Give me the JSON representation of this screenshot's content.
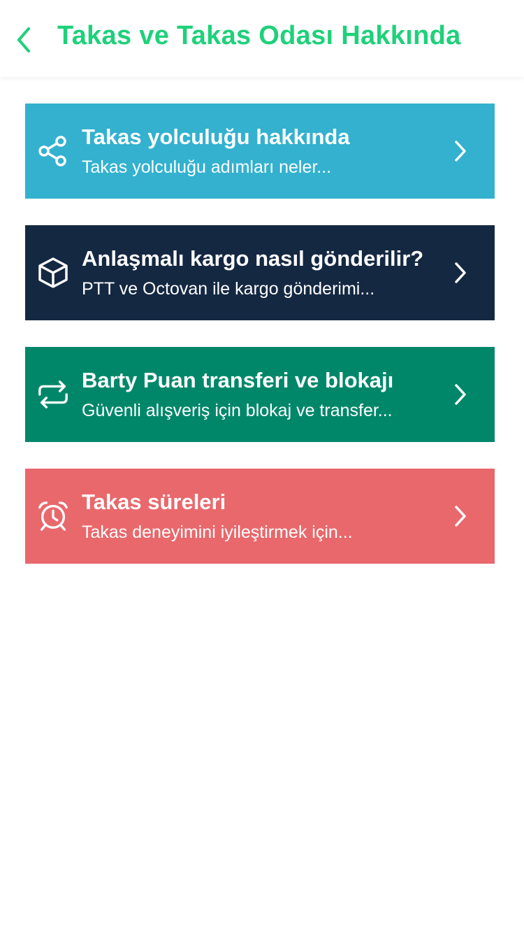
{
  "header": {
    "title": "Takas ve Takas Odası Hakkında",
    "back_icon": "chevron-left-icon",
    "accent_color": "#1ed17a"
  },
  "cards": [
    {
      "title": "Takas yolculuğu hakkında",
      "subtitle": "Takas yolculuğu adımları neler...",
      "icon": "share-icon",
      "color": "#33b1cf"
    },
    {
      "title": "Anlaşmalı kargo nasıl gönderilir?",
      "subtitle": "PTT ve Octovan ile kargo gönderimi...",
      "icon": "box-icon",
      "color": "#152842"
    },
    {
      "title": "Barty Puan transferi ve blokajı",
      "subtitle": "Güvenli alışveriş için blokaj ve transfer...",
      "icon": "repeat-icon",
      "color": "#00876a"
    },
    {
      "title": "Takas süreleri",
      "subtitle": "Takas deneyimini iyileştirmek için...",
      "icon": "alarm-clock-icon",
      "color": "#e9686c"
    }
  ]
}
